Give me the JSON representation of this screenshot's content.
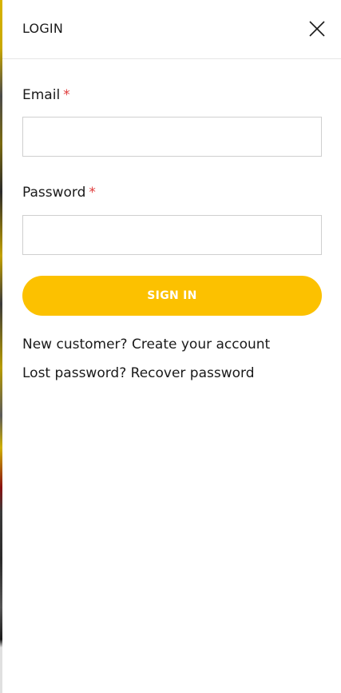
{
  "header": {
    "title": "LOGIN",
    "close_icon": "close-icon"
  },
  "form": {
    "email": {
      "label": "Email",
      "required_mark": "*",
      "value": "",
      "placeholder": ""
    },
    "password": {
      "label": "Password",
      "required_mark": "*",
      "value": "",
      "placeholder": ""
    },
    "submit_label": "SIGN IN"
  },
  "links": {
    "new_customer_prefix": "New customer?",
    "create_account": "Create your account",
    "lost_password_prefix": "Lost password?",
    "recover_password": "Recover password"
  },
  "colors": {
    "accent": "#fcc100",
    "required": "#e03b3b",
    "text": "#1a1a1a",
    "border": "#cfcfcf"
  }
}
